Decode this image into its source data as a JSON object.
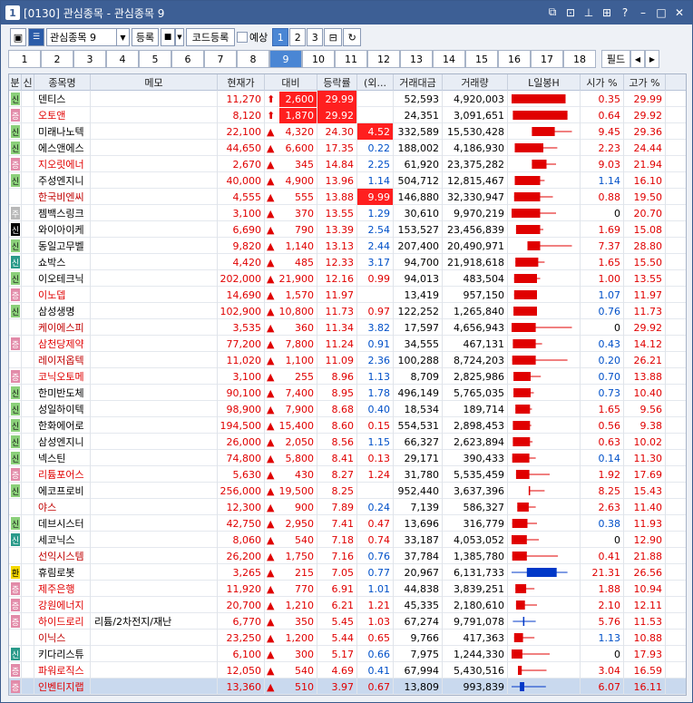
{
  "window": {
    "number": "1",
    "title": "[0130] 관심종목 - 관심종목 9"
  },
  "toolbar": {
    "group_select": "관심종목 9",
    "register": "등록",
    "code_register": "코드등록",
    "forecast": "예상",
    "pages": [
      "1",
      "2",
      "3"
    ]
  },
  "tabs": [
    "1",
    "2",
    "3",
    "4",
    "5",
    "6",
    "7",
    "8",
    "9",
    "10",
    "11",
    "12",
    "13",
    "14",
    "15",
    "16",
    "17",
    "18"
  ],
  "active_tab": "9",
  "field_button": "필드",
  "columns": [
    "분",
    "신",
    "종목명",
    "메모",
    "현재가",
    "대비",
    "등락률",
    "(외...",
    "거래대금",
    "거래량",
    "L일봉H",
    "시가 %",
    "고가 %"
  ],
  "colors": {
    "up": "#e00000",
    "down": "#0050c8",
    "candle_up": "#e00000",
    "candle_down": "#0038c8"
  },
  "rows": [
    {
      "name": "덴티스",
      "gubun": "신",
      "gtype": "g",
      "memo": "",
      "price": "11,270",
      "diff": "2,600",
      "dir": "upper",
      "rate": "29.99",
      "foreign": "",
      "amount": "52,593",
      "volume": "4,920,003",
      "open_pct": "0.35",
      "high_pct": "29.99",
      "rate_hl": true,
      "candle": {
        "body": [
          0.0,
          0.85
        ],
        "wick": [
          0.0,
          0.85
        ],
        "dir": "up"
      }
    },
    {
      "name": "오토앤",
      "gubun": "증",
      "gtype": "p",
      "memo": "",
      "price": "8,120",
      "diff": "1,870",
      "dir": "upper",
      "rate": "29.92",
      "foreign": "",
      "amount": "24,351",
      "volume": "3,091,651",
      "open_pct": "0.64",
      "high_pct": "29.92",
      "rate_hl": true,
      "candle": {
        "body": [
          0.02,
          0.88
        ],
        "wick": [
          0.02,
          0.88
        ],
        "dir": "up"
      }
    },
    {
      "name": "미래나노텍",
      "gubun": "신",
      "gtype": "g",
      "memo": "",
      "price": "22,100",
      "diff": "4,320",
      "dir": "up",
      "rate": "24.30",
      "foreign": "4.52",
      "foreign_hl": true,
      "amount": "332,589",
      "volume": "15,530,428",
      "open_pct": "9.45",
      "high_pct": "29.36",
      "candle": {
        "body": [
          0.32,
          0.68
        ],
        "wick": [
          0.32,
          0.95
        ],
        "dir": "up"
      }
    },
    {
      "name": "에스앤에스",
      "gubun": "신",
      "gtype": "g",
      "memo": "",
      "price": "44,650",
      "diff": "6,600",
      "dir": "up",
      "rate": "17.35",
      "foreign": "0.22",
      "fdir": "dn",
      "amount": "188,002",
      "volume": "4,186,930",
      "open_pct": "2.23",
      "high_pct": "24.44",
      "candle": {
        "body": [
          0.05,
          0.5
        ],
        "wick": [
          0.05,
          0.72
        ],
        "dir": "up"
      }
    },
    {
      "name": "지오릿에너",
      "gubun": "증",
      "gtype": "p",
      "memo": "",
      "price": "2,670",
      "diff": "345",
      "dir": "up",
      "rate": "14.84",
      "foreign": "2.25",
      "fdir": "dn",
      "amount": "61,920",
      "volume": "23,375,282",
      "open_pct": "9.03",
      "high_pct": "21.94",
      "candle": {
        "body": [
          0.32,
          0.55
        ],
        "wick": [
          0.32,
          0.7
        ],
        "dir": "up"
      }
    },
    {
      "name": "주성엔지니",
      "gubun": "신",
      "gtype": "g",
      "memo": "",
      "price": "40,000",
      "diff": "4,900",
      "dir": "up",
      "rate": "13.96",
      "foreign": "1.14",
      "fdir": "dn",
      "amount": "504,712",
      "volume": "12,815,467",
      "open_pct": "1.14",
      "high_pct": "16.10",
      "candle": {
        "body": [
          0.05,
          0.45
        ],
        "wick": [
          0.05,
          0.52
        ],
        "dir": "up"
      }
    },
    {
      "name": "한국비엔씨",
      "gubun": "",
      "gtype": "",
      "memo": "",
      "price": "4,555",
      "diff": "555",
      "dir": "up",
      "rate": "13.88",
      "foreign": "9.99",
      "foreign_hl": true,
      "amount": "146,880",
      "volume": "32,330,947",
      "open_pct": "0.88",
      "high_pct": "19.50",
      "candle": {
        "body": [
          0.04,
          0.45
        ],
        "wick": [
          0.04,
          0.65
        ],
        "dir": "up"
      }
    },
    {
      "name": "젬백스링크",
      "gubun": "주",
      "gtype": "s",
      "memo": "",
      "price": "3,100",
      "diff": "370",
      "dir": "up",
      "rate": "13.55",
      "foreign": "1.29",
      "fdir": "dn",
      "amount": "30,610",
      "volume": "9,970,219",
      "open_pct": "0",
      "high_pct": "20.70",
      "candle": {
        "body": [
          0.0,
          0.45
        ],
        "wick": [
          0.0,
          0.7
        ],
        "dir": "up"
      }
    },
    {
      "name": "와이아이케",
      "gubun": "신",
      "gtype": "k",
      "memo": "",
      "price": "6,690",
      "diff": "790",
      "dir": "up",
      "rate": "13.39",
      "foreign": "2.54",
      "fdir": "dn",
      "amount": "153,527",
      "volume": "23,456,839",
      "open_pct": "1.69",
      "high_pct": "15.08",
      "candle": {
        "body": [
          0.07,
          0.45
        ],
        "wick": [
          0.07,
          0.5
        ],
        "dir": "up"
      }
    },
    {
      "name": "동일고무벨",
      "gubun": "신",
      "gtype": "g",
      "memo": "",
      "price": "9,820",
      "diff": "1,140",
      "dir": "up",
      "rate": "13.13",
      "foreign": "2.44",
      "fdir": "dn",
      "amount": "207,400",
      "volume": "20,490,971",
      "open_pct": "7.37",
      "high_pct": "28.80",
      "candle": {
        "body": [
          0.25,
          0.45
        ],
        "wick": [
          0.25,
          0.95
        ],
        "dir": "up"
      }
    },
    {
      "name": "쇼박스",
      "gubun": "신",
      "gtype": "t",
      "memo": "",
      "price": "4,420",
      "diff": "485",
      "dir": "up",
      "rate": "12.33",
      "foreign": "3.17",
      "fdir": "dn",
      "amount": "94,700",
      "volume": "21,918,618",
      "open_pct": "1.65",
      "high_pct": "15.50",
      "candle": {
        "body": [
          0.06,
          0.42
        ],
        "wick": [
          0.06,
          0.52
        ],
        "dir": "up"
      }
    },
    {
      "name": "이오테크닉",
      "gubun": "신",
      "gtype": "g",
      "memo": "",
      "price": "202,000",
      "diff": "21,900",
      "dir": "up",
      "rate": "12.16",
      "foreign": "0.99",
      "fdir": "up",
      "amount": "94,013",
      "volume": "483,504",
      "open_pct": "1.00",
      "high_pct": "13.55",
      "candle": {
        "body": [
          0.04,
          0.4
        ],
        "wick": [
          0.04,
          0.45
        ],
        "dir": "up"
      }
    },
    {
      "name": "이노뎁",
      "gubun": "증",
      "gtype": "p",
      "memo": "",
      "price": "14,690",
      "diff": "1,570",
      "dir": "up",
      "rate": "11.97",
      "foreign": "",
      "amount": "13,419",
      "volume": "957,150",
      "open_pct": "1.07",
      "high_pct": "11.97",
      "candle": {
        "body": [
          0.04,
          0.4
        ],
        "wick": [
          0.04,
          0.4
        ],
        "dir": "up"
      }
    },
    {
      "name": "삼성생명",
      "gubun": "신",
      "gtype": "g",
      "memo": "",
      "price": "102,900",
      "diff": "10,800",
      "dir": "up",
      "rate": "11.73",
      "foreign": "0.97",
      "fdir": "up",
      "amount": "122,252",
      "volume": "1,265,840",
      "open_pct": "0.76",
      "high_pct": "11.73",
      "candle": {
        "body": [
          0.03,
          0.4
        ],
        "wick": [
          0.03,
          0.4
        ],
        "dir": "up"
      }
    },
    {
      "name": "케이에스피",
      "gubun": "",
      "gtype": "",
      "memo": "",
      "price": "3,535",
      "diff": "360",
      "dir": "up",
      "rate": "11.34",
      "foreign": "3.82",
      "fdir": "dn",
      "amount": "17,597",
      "volume": "4,656,943",
      "open_pct": "0",
      "high_pct": "29.92",
      "candle": {
        "body": [
          0.0,
          0.38
        ],
        "wick": [
          0.0,
          0.95
        ],
        "dir": "up"
      }
    },
    {
      "name": "삼천당제약",
      "gubun": "증",
      "gtype": "p",
      "memo": "",
      "price": "77,200",
      "diff": "7,800",
      "dir": "up",
      "rate": "11.24",
      "foreign": "0.91",
      "fdir": "dn",
      "amount": "34,555",
      "volume": "467,131",
      "open_pct": "0.43",
      "high_pct": "14.12",
      "candle": {
        "body": [
          0.02,
          0.38
        ],
        "wick": [
          0.02,
          0.48
        ],
        "dir": "up"
      }
    },
    {
      "name": "레이저옵텍",
      "gubun": "",
      "gtype": "",
      "memo": "",
      "price": "11,020",
      "diff": "1,100",
      "dir": "up",
      "rate": "11.09",
      "foreign": "2.36",
      "fdir": "dn",
      "amount": "100,288",
      "volume": "8,724,203",
      "open_pct": "0.20",
      "high_pct": "26.21",
      "candle": {
        "body": [
          0.01,
          0.38
        ],
        "wick": [
          0.01,
          0.88
        ],
        "dir": "up"
      }
    },
    {
      "name": "코닉오토메",
      "gubun": "증",
      "gtype": "p",
      "memo": "",
      "price": "3,100",
      "diff": "255",
      "dir": "up",
      "rate": "8.96",
      "foreign": "1.13",
      "fdir": "dn",
      "amount": "8,709",
      "volume": "2,825,986",
      "open_pct": "0.70",
      "high_pct": "13.88",
      "candle": {
        "body": [
          0.03,
          0.3
        ],
        "wick": [
          0.03,
          0.46
        ],
        "dir": "up"
      }
    },
    {
      "name": "한미반도체",
      "gubun": "신",
      "gtype": "g",
      "memo": "",
      "price": "90,100",
      "diff": "7,400",
      "dir": "up",
      "rate": "8.95",
      "foreign": "1.78",
      "fdir": "dn",
      "amount": "496,149",
      "volume": "5,765,035",
      "open_pct": "0.73",
      "high_pct": "10.40",
      "candle": {
        "body": [
          0.03,
          0.3
        ],
        "wick": [
          0.03,
          0.35
        ],
        "dir": "up"
      }
    },
    {
      "name": "성일하이텍",
      "gubun": "신",
      "gtype": "g",
      "memo": "",
      "price": "98,900",
      "diff": "7,900",
      "dir": "up",
      "rate": "8.68",
      "foreign": "0.40",
      "fdir": "dn",
      "amount": "18,534",
      "volume": "189,714",
      "open_pct": "1.65",
      "high_pct": "9.56",
      "candle": {
        "body": [
          0.06,
          0.29
        ],
        "wick": [
          0.06,
          0.32
        ],
        "dir": "up"
      }
    },
    {
      "name": "한화에어로",
      "gubun": "신",
      "gtype": "g",
      "memo": "",
      "price": "194,500",
      "diff": "15,400",
      "dir": "up",
      "rate": "8.60",
      "foreign": "0.15",
      "fdir": "up",
      "amount": "554,531",
      "volume": "2,898,453",
      "open_pct": "0.56",
      "high_pct": "9.38",
      "candle": {
        "body": [
          0.02,
          0.29
        ],
        "wick": [
          0.02,
          0.31
        ],
        "dir": "up"
      }
    },
    {
      "name": "삼성엔지니",
      "gubun": "신",
      "gtype": "g",
      "memo": "",
      "price": "26,000",
      "diff": "2,050",
      "dir": "up",
      "rate": "8.56",
      "foreign": "1.15",
      "fdir": "dn",
      "amount": "66,327",
      "volume": "2,623,894",
      "open_pct": "0.63",
      "high_pct": "10.02",
      "candle": {
        "body": [
          0.02,
          0.29
        ],
        "wick": [
          0.02,
          0.33
        ],
        "dir": "up"
      }
    },
    {
      "name": "넥스틴",
      "gubun": "신",
      "gtype": "g",
      "memo": "",
      "price": "74,800",
      "diff": "5,800",
      "dir": "up",
      "rate": "8.41",
      "foreign": "0.13",
      "fdir": "up",
      "amount": "29,171",
      "volume": "390,433",
      "open_pct": "0.14",
      "high_pct": "11.30",
      "candle": {
        "body": [
          0.01,
          0.28
        ],
        "wick": [
          0.01,
          0.38
        ],
        "dir": "up"
      }
    },
    {
      "name": "리튬포어스",
      "gubun": "증",
      "gtype": "p",
      "memo": "",
      "price": "5,630",
      "diff": "430",
      "dir": "up",
      "rate": "8.27",
      "foreign": "1.24",
      "fdir": "up",
      "amount": "31,780",
      "volume": "5,535,459",
      "open_pct": "1.92",
      "high_pct": "17.69",
      "candle": {
        "body": [
          0.07,
          0.28
        ],
        "wick": [
          0.07,
          0.6
        ],
        "dir": "up"
      }
    },
    {
      "name": "에코프로비",
      "gubun": "신",
      "gtype": "g",
      "memo": "",
      "price": "256,000",
      "diff": "19,500",
      "dir": "up",
      "rate": "8.25",
      "foreign": "",
      "amount": "952,440",
      "volume": "3,637,396",
      "open_pct": "8.25",
      "high_pct": "15.43",
      "candle": {
        "body": [
          0.27,
          0.29
        ],
        "wick": [
          0.27,
          0.52
        ],
        "dir": "up"
      }
    },
    {
      "name": "야스",
      "gubun": "",
      "gtype": "",
      "memo": "",
      "price": "12,300",
      "diff": "900",
      "dir": "up",
      "rate": "7.89",
      "foreign": "0.24",
      "fdir": "dn",
      "amount": "7,139",
      "volume": "586,327",
      "open_pct": "2.63",
      "high_pct": "11.40",
      "candle": {
        "body": [
          0.09,
          0.27
        ],
        "wick": [
          0.09,
          0.38
        ],
        "dir": "up"
      }
    },
    {
      "name": "데브시스터",
      "gubun": "신",
      "gtype": "g",
      "memo": "",
      "price": "42,750",
      "diff": "2,950",
      "dir": "up",
      "rate": "7.41",
      "foreign": "0.47",
      "fdir": "up",
      "amount": "13,696",
      "volume": "316,779",
      "open_pct": "0.38",
      "high_pct": "11.93",
      "candle": {
        "body": [
          0.01,
          0.25
        ],
        "wick": [
          0.01,
          0.4
        ],
        "dir": "up"
      }
    },
    {
      "name": "세코닉스",
      "gubun": "신",
      "gtype": "t",
      "memo": "",
      "price": "8,060",
      "diff": "540",
      "dir": "up",
      "rate": "7.18",
      "foreign": "0.74",
      "fdir": "up",
      "amount": "33,187",
      "volume": "4,053,052",
      "open_pct": "0",
      "high_pct": "12.90",
      "candle": {
        "body": [
          0.0,
          0.24
        ],
        "wick": [
          0.0,
          0.43
        ],
        "dir": "up"
      }
    },
    {
      "name": "선익시스템",
      "gubun": "",
      "gtype": "",
      "memo": "",
      "price": "26,200",
      "diff": "1,750",
      "dir": "up",
      "rate": "7.16",
      "foreign": "0.76",
      "fdir": "dn",
      "amount": "37,784",
      "volume": "1,385,780",
      "open_pct": "0.41",
      "high_pct": "21.88",
      "candle": {
        "body": [
          0.01,
          0.24
        ],
        "wick": [
          0.01,
          0.73
        ],
        "dir": "up"
      }
    },
    {
      "name": "휴림로봇",
      "gubun": "환",
      "gtype": "y",
      "memo": "",
      "price": "3,265",
      "diff": "215",
      "dir": "up",
      "rate": "7.05",
      "foreign": "0.77",
      "fdir": "dn",
      "amount": "20,967",
      "volume": "6,131,733",
      "open_pct": "21.31",
      "high_pct": "26.56",
      "candle": {
        "body": [
          0.24,
          0.71
        ],
        "wick": [
          0.0,
          0.88
        ],
        "dir": "down"
      }
    },
    {
      "name": "제주은행",
      "gubun": "증",
      "gtype": "p",
      "memo": "",
      "price": "11,920",
      "diff": "770",
      "dir": "up",
      "rate": "6.91",
      "foreign": "1.01",
      "fdir": "dn",
      "amount": "44,838",
      "volume": "3,839,251",
      "open_pct": "1.88",
      "high_pct": "10.94",
      "candle": {
        "body": [
          0.06,
          0.23
        ],
        "wick": [
          0.06,
          0.36
        ],
        "dir": "up"
      }
    },
    {
      "name": "강원에너지",
      "gubun": "증",
      "gtype": "p",
      "memo": "",
      "price": "20,700",
      "diff": "1,210",
      "dir": "up",
      "rate": "6.21",
      "foreign": "1.21",
      "fdir": "up",
      "amount": "45,335",
      "volume": "2,180,610",
      "open_pct": "2.10",
      "high_pct": "12.11",
      "candle": {
        "body": [
          0.07,
          0.21
        ],
        "wick": [
          0.07,
          0.4
        ],
        "dir": "up"
      }
    },
    {
      "name": "하이드로리",
      "gubun": "증",
      "gtype": "p",
      "memo": "리튬/2차전지/재난",
      "price": "6,770",
      "diff": "350",
      "dir": "up",
      "rate": "5.45",
      "foreign": "1.03",
      "fdir": "up",
      "amount": "67,274",
      "volume": "9,791,078",
      "open_pct": "5.76",
      "high_pct": "11.53",
      "candle": {
        "body": [
          0.18,
          0.19
        ],
        "wick": [
          0.02,
          0.38
        ],
        "dir": "down"
      }
    },
    {
      "name": "이닉스",
      "gubun": "",
      "gtype": "",
      "memo": "",
      "price": "23,250",
      "diff": "1,200",
      "dir": "up",
      "rate": "5.44",
      "foreign": "0.65",
      "fdir": "up",
      "amount": "9,766",
      "volume": "417,363",
      "open_pct": "1.13",
      "high_pct": "10.88",
      "candle": {
        "body": [
          0.04,
          0.18
        ],
        "wick": [
          0.04,
          0.36
        ],
        "dir": "up"
      }
    },
    {
      "name": "키다리스튜",
      "gubun": "신",
      "gtype": "t",
      "memo": "",
      "price": "6,100",
      "diff": "300",
      "dir": "up",
      "rate": "5.17",
      "foreign": "0.66",
      "fdir": "dn",
      "amount": "7,975",
      "volume": "1,244,330",
      "open_pct": "0",
      "high_pct": "17.93",
      "candle": {
        "body": [
          0.0,
          0.17
        ],
        "wick": [
          0.0,
          0.6
        ],
        "dir": "up"
      }
    },
    {
      "name": "파워로직스",
      "gubun": "증",
      "gtype": "p",
      "memo": "",
      "price": "12,050",
      "diff": "540",
      "dir": "up",
      "rate": "4.69",
      "foreign": "0.41",
      "fdir": "dn",
      "amount": "67,994",
      "volume": "5,430,516",
      "open_pct": "3.04",
      "high_pct": "16.59",
      "candle": {
        "body": [
          0.1,
          0.16
        ],
        "wick": [
          0.1,
          0.55
        ],
        "dir": "up"
      }
    },
    {
      "name": "인벤티지랩",
      "gubun": "증",
      "gtype": "p",
      "memo": "",
      "price": "13,360",
      "diff": "510",
      "dir": "up",
      "rate": "3.97",
      "foreign": "0.67",
      "fdir": "up",
      "amount": "13,809",
      "volume": "993,839",
      "open_pct": "6.07",
      "high_pct": "16.11",
      "sel": true,
      "candle": {
        "body": [
          0.13,
          0.2
        ],
        "wick": [
          0.0,
          0.54
        ],
        "dir": "down"
      }
    }
  ]
}
